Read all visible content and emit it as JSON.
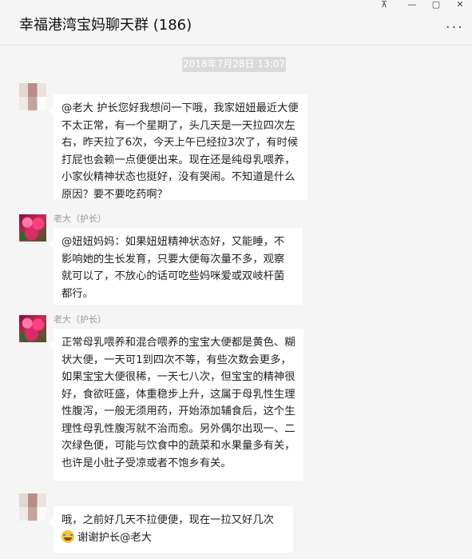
{
  "window": {
    "title": "幸福港湾宝妈聊天群 (186)",
    "pin_icon": "pin-icon",
    "minimize_icon": "minimize-icon",
    "maximize_icon": "maximize-icon",
    "close_icon": "close-icon",
    "more_label": "···"
  },
  "chat": {
    "timestamp": "2018年7月28日 13:07",
    "messages": [
      {
        "sender": "",
        "avatar": "blurred-avatar",
        "text": "@老大 护长您好我想问一下哦，我家妞妞最近大便不太正常，有一个星期了，头几天是一天拉四次左右，昨天拉了6次，今天上午已经拉3次了，有时候打屁也会赖一点便便出来。现在还是纯母乳喂养，小家伙精神状态也挺好，没有哭闹。不知道是什么原因？要不要吃药啊？"
      },
      {
        "sender": "老大（护长）",
        "avatar": "flower-avatar",
        "text": "@妞妞妈妈：如果妞妞精神状态好，又能睡，不影响她的生长发育，只要大便每次量不多，观察就可以了，不放心的话可吃些妈咪爱或双岐杆菌都行。"
      },
      {
        "sender": "老大（护长）",
        "avatar": "flower-avatar",
        "text": "正常母乳喂养和混合喂养的宝宝大便都是黄色、糊状大便，一天可1到四次不等，有些次数会更多，如果宝宝大便很稀，一天七八次，但宝宝的精神很好，食欲旺盛，体重稳步上升，这属于母乳性生理性腹泻，一般无须用药，开始添加辅食后，这个生理性母乳性腹泻就不治而愈。另外偶尔出现一、二次绿色便，可能与饮食中的蔬菜和水果量多有关，也许是小肚子受凉或者不饱乡有关。"
      },
      {
        "sender": "",
        "avatar": "blurred-avatar",
        "text_line1": "哦，之前好几天不拉便便，现在一拉又好几次",
        "emoji": "laughing-crying-emoji",
        "text_line2": "谢谢护长@老大"
      }
    ]
  }
}
